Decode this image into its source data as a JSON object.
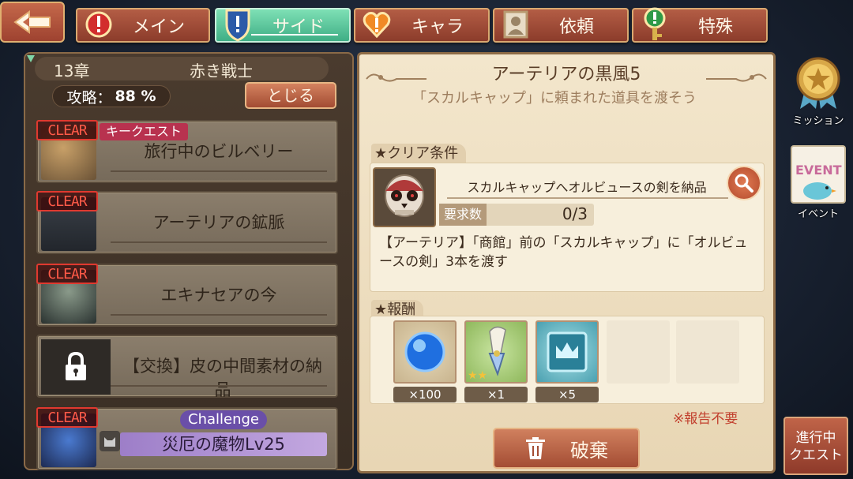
{
  "top_nav": {
    "back_icon": "back-arrow-icon",
    "tabs": [
      {
        "label": "メイン",
        "icon": "exclamation-shield-icon",
        "active": false
      },
      {
        "label": "サイド",
        "icon": "exclamation-shield-icon",
        "active": true
      },
      {
        "label": "キャラ",
        "icon": "heart-icon",
        "active": false
      },
      {
        "label": "依頼",
        "icon": "portrait-icon",
        "active": false
      },
      {
        "label": "特殊",
        "icon": "key-icon",
        "active": false
      }
    ]
  },
  "chapter": {
    "number": "13章",
    "title": "赤き戦士",
    "progress_label": "攻略：",
    "progress_value": "88 %",
    "progress": 0.88,
    "close_label": "とじる"
  },
  "quests": [
    {
      "title": "旅行中のビルベリー",
      "clear": "CLEAR",
      "badge": "キークエスト"
    },
    {
      "title": "アーテリアの鉱脈",
      "clear": "CLEAR"
    },
    {
      "title": "エキナセアの今",
      "clear": "CLEAR"
    },
    {
      "title": "【交換】皮の中間素材の納品",
      "locked": true
    },
    {
      "title": "災厄の魔物Lv25",
      "clear": "CLEAR",
      "badge": "Challenge"
    }
  ],
  "detail": {
    "title": "アーテリアの黒風5",
    "subtitle": "「スカルキャップ」に頼まれた道具を渡そう",
    "conditions_label": "クリア条件",
    "target_text": "スカルキャップへオルビュースの剣を納品",
    "required_label": "要求数",
    "required_value": "0/3",
    "description": "【アーテリア】「商館」前の「スカルキャップ」に「オルビュースの剣」3本を渡す",
    "rewards_label": "報酬",
    "rewards": [
      {
        "name": "blue-orb-icon",
        "count": "×100"
      },
      {
        "name": "feather-potion-icon",
        "count": "×1",
        "stars": 2
      },
      {
        "name": "crown-crystal-icon",
        "count": "×5"
      }
    ],
    "no_report": "※報告不要",
    "discard_label": "破棄"
  },
  "side": {
    "mission_label": "ミッション",
    "event_label": "イベント",
    "event_tag": "EVENT",
    "ongoing_line1": "進行中",
    "ongoing_line2": "クエスト"
  },
  "colors": {
    "active_tab": "#5cc89d",
    "tab": "#a44d34",
    "clear": "#e0392f",
    "challenge": "#6a4fa8"
  }
}
